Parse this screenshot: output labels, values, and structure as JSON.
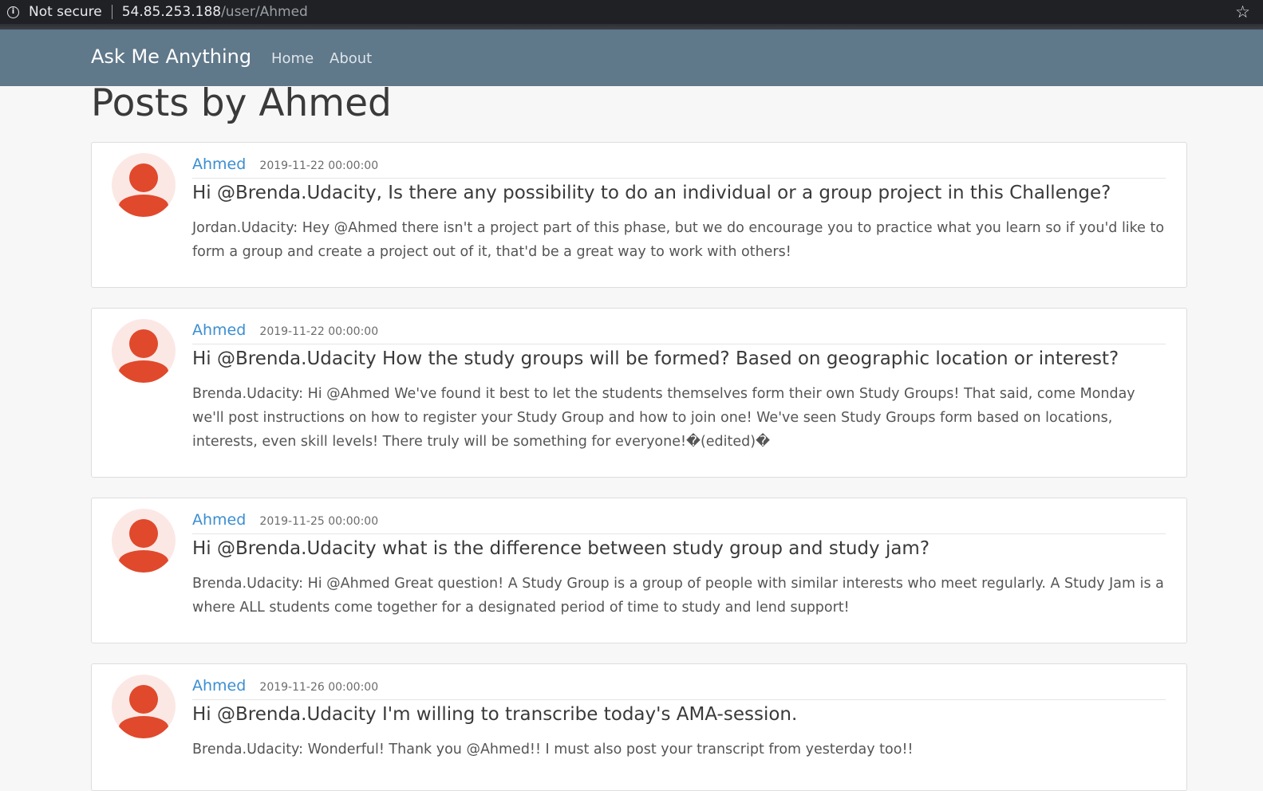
{
  "browser": {
    "info_icon": "i",
    "security_label": "Not secure",
    "url_host": "54.85.253.188",
    "url_path": "/user/Ahmed",
    "star_icon": "☆"
  },
  "navbar": {
    "brand": "Ask Me Anything",
    "links": [
      {
        "label": "Home"
      },
      {
        "label": "About"
      }
    ]
  },
  "page": {
    "title": "Posts by Ahmed"
  },
  "posts": [
    {
      "author": "Ahmed",
      "date": "2019-11-22 00:00:00",
      "title": "Hi @Brenda.Udacity, Is there any possibility to do an individual or a group project in this Challenge?",
      "body": "Jordan.Udacity: Hey @Ahmed there isn't a project part of this phase, but we do encourage you to practice what you learn so if you'd like to form a group and create a project out of it, that'd be a great way to work with others!"
    },
    {
      "author": "Ahmed",
      "date": "2019-11-22 00:00:00",
      "title": "Hi @Brenda.Udacity How the study groups will be formed? Based on geographic location or interest?",
      "body": "Brenda.Udacity: Hi @Ahmed We've found it best to let the students themselves form their own Study Groups! That said, come Monday we'll post instructions on how to register your Study Group and how to join one! We've seen Study Groups form based on locations, interests, even skill levels! There truly will be something for everyone!�(edited)�"
    },
    {
      "author": "Ahmed",
      "date": "2019-11-25 00:00:00",
      "title": "Hi @Brenda.Udacity what is the difference between study group and study jam?",
      "body": "Brenda.Udacity: Hi @Ahmed Great question! A Study Group is a group of people with similar interests who meet regularly. A Study Jam is a where ALL students come together for a designated period of time to study and lend support!"
    },
    {
      "author": "Ahmed",
      "date": "2019-11-26 00:00:00",
      "title": "Hi @Brenda.Udacity I'm willing to transcribe today's AMA-session.",
      "body": "Brenda.Udacity: Wonderful! Thank you @Ahmed!! I must also post your transcript from yesterday too!!"
    }
  ]
}
